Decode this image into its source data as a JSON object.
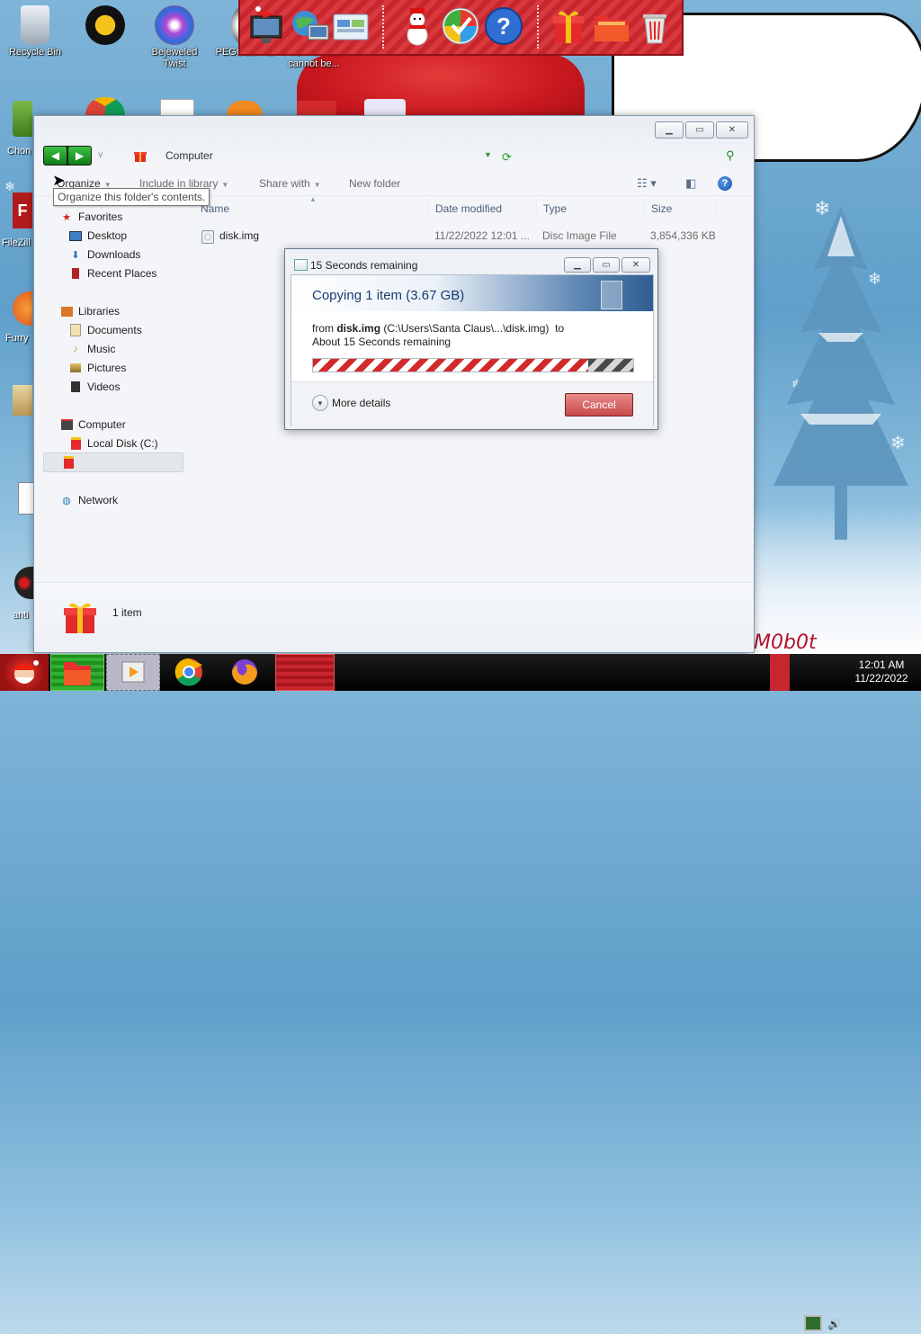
{
  "desktop": {
    "icons": [
      {
        "label": "Recycle Bin",
        "icon": "recycle-bin-icon"
      },
      {
        "label": "",
        "icon": "aim-icon"
      },
      {
        "label": "Bejeweled Twist",
        "icon": "bejeweled-icon"
      },
      {
        "label": "PEGGLE ME",
        "icon": "peggle-icon"
      },
      {
        "label": "I SERIOUSLY cannot be...",
        "icon": "document-icon"
      },
      {
        "label": "",
        "icon": "flash-file-icon"
      }
    ],
    "left_labels": [
      "Chon",
      "FileZill",
      "Furry",
      "",
      "",
      "anti"
    ],
    "speech_bubble": "",
    "watermark": "M0b0t"
  },
  "dock": {
    "icons": [
      "santa-monitor-icon",
      "globe-network-icon",
      "control-panel-icon",
      "snowman-icon",
      "windows-update-icon",
      "help-icon",
      "gift-box-icon",
      "folder-icon",
      "trash-can-icon"
    ]
  },
  "explorer": {
    "address": {
      "root": "Computer",
      "current": ""
    },
    "search_placeholder": "",
    "toolbar": {
      "organize": "Organize",
      "include": "Include in library",
      "share": "Share with",
      "new_folder": "New folder"
    },
    "tooltip": "Organize this folder's contents.",
    "nav": {
      "favorites": "Favorites",
      "favorites_items": [
        "Desktop",
        "Downloads",
        "Recent Places"
      ],
      "libraries": "Libraries",
      "libraries_items": [
        "Documents",
        "Music",
        "Pictures",
        "Videos"
      ],
      "computer": "Computer",
      "computer_items": [
        "Local Disk (C:)",
        ""
      ],
      "network": "Network"
    },
    "columns": [
      "Name",
      "Date modified",
      "Type",
      "Size"
    ],
    "files": [
      {
        "name": "disk.img",
        "date": "11/22/2022 12:01 ...",
        "type": "Disc Image File",
        "size": "3,854,336 KB"
      }
    ],
    "status": "1 item"
  },
  "copy_dialog": {
    "title": "15 Seconds remaining",
    "heading": "Copying 1 item (3.67 GB)",
    "from_label": "from",
    "from_file": "disk.img",
    "from_path": "(C:\\Users\\Santa Claus\\...\\disk.img)",
    "to_label": "to",
    "to_dest": "",
    "remaining": "About 15 Seconds remaining",
    "progress": 0.86,
    "more_details": "More details",
    "cancel": "Cancel"
  },
  "taskbar": {
    "time": "12:01 AM",
    "date": "11/22/2022"
  }
}
